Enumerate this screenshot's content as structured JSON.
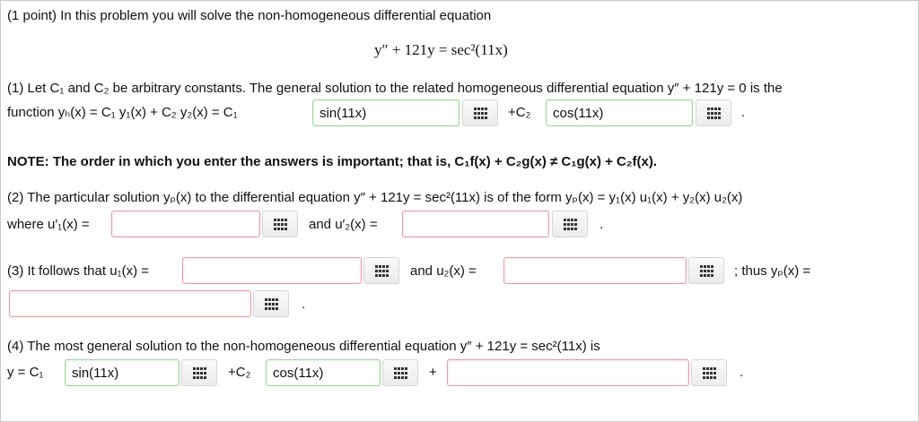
{
  "header": {
    "text": "(1 point) In this problem you will solve the non-homogeneous differential equation"
  },
  "equation": "y″ + 121y = sec²(11x)",
  "part1": {
    "line1": "(1) Let C₁ and C₂ be arbitrary constants. The general solution to the related homogeneous differential equation y″ + 121y = 0 is the",
    "prefix": "function yₕ(x) = C₁ y₁(x) + C₂ y₂(x) = C₁",
    "answer1": "sin(11x)",
    "mid": "+C₂",
    "answer2": "cos(11x)",
    "end": "."
  },
  "note": "NOTE: The order in which you enter the answers is important; that is, C₁f(x) + C₂g(x) ≠ C₁g(x) + C₂f(x).",
  "part2": {
    "line1": "(2) The particular solution yₚ(x) to the differential equation y″ + 121y = sec²(11x) is of the form yₚ(x) = y₁(x) u₁(x) + y₂(x) u₂(x)",
    "prefix": "where u′₁(x) =",
    "mid": "and u′₂(x) =",
    "end": "."
  },
  "part3": {
    "prefix": "(3) It follows that u₁(x) =",
    "mid": "and u₂(x) =",
    "suffix": "; thus yₚ(x) =",
    "end": "."
  },
  "part4": {
    "line1": "(4) The most general solution to the non-homogeneous differential equation y″ + 121y = sec²(11x) is",
    "prefix": "y = C₁",
    "answer1": "sin(11x)",
    "mid": "+C₂",
    "answer2": "cos(11x)",
    "plus": "+",
    "end": "."
  },
  "colors": {
    "error_border": "#e79aa0",
    "correct_border": "#9fd19a"
  },
  "icons": {
    "keyboard": "grid-keypad-icon"
  }
}
